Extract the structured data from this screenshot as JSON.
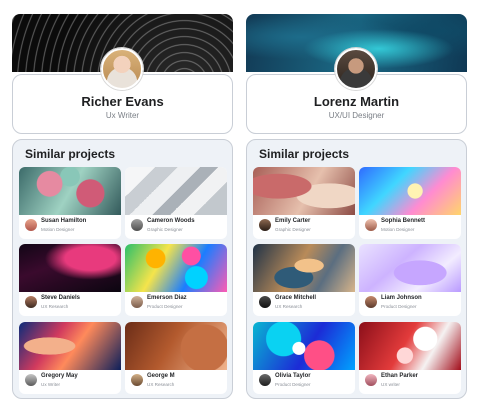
{
  "profiles": [
    {
      "name": "Richer Evans",
      "role": "Ux Writer",
      "projects_title": "Similar projects",
      "projects": [
        {
          "name": "Susan Hamilton",
          "role": "Motion Designer"
        },
        {
          "name": "Cameron Woods",
          "role": "Graphic Designer"
        },
        {
          "name": "Steve Daniels",
          "role": "UX Research"
        },
        {
          "name": "Emerson Diaz",
          "role": "Product Designer"
        },
        {
          "name": "Gregory May",
          "role": "Ux Writer"
        },
        {
          "name": "George M",
          "role": "UX Research"
        }
      ]
    },
    {
      "name": "Lorenz Martin",
      "role": "UX/UI Designer",
      "projects_title": "Similar projects",
      "projects": [
        {
          "name": "Emily Carter",
          "role": "Graphic Designer"
        },
        {
          "name": "Sophia Bennett",
          "role": "Motion Designer"
        },
        {
          "name": "Grace Mitchell",
          "role": "UX Research"
        },
        {
          "name": "Liam Johnson",
          "role": "Product Designer"
        },
        {
          "name": "Olivia Taylor",
          "role": "Product Designer"
        },
        {
          "name": "Ethan Parker",
          "role": "UX writer"
        }
      ]
    }
  ]
}
